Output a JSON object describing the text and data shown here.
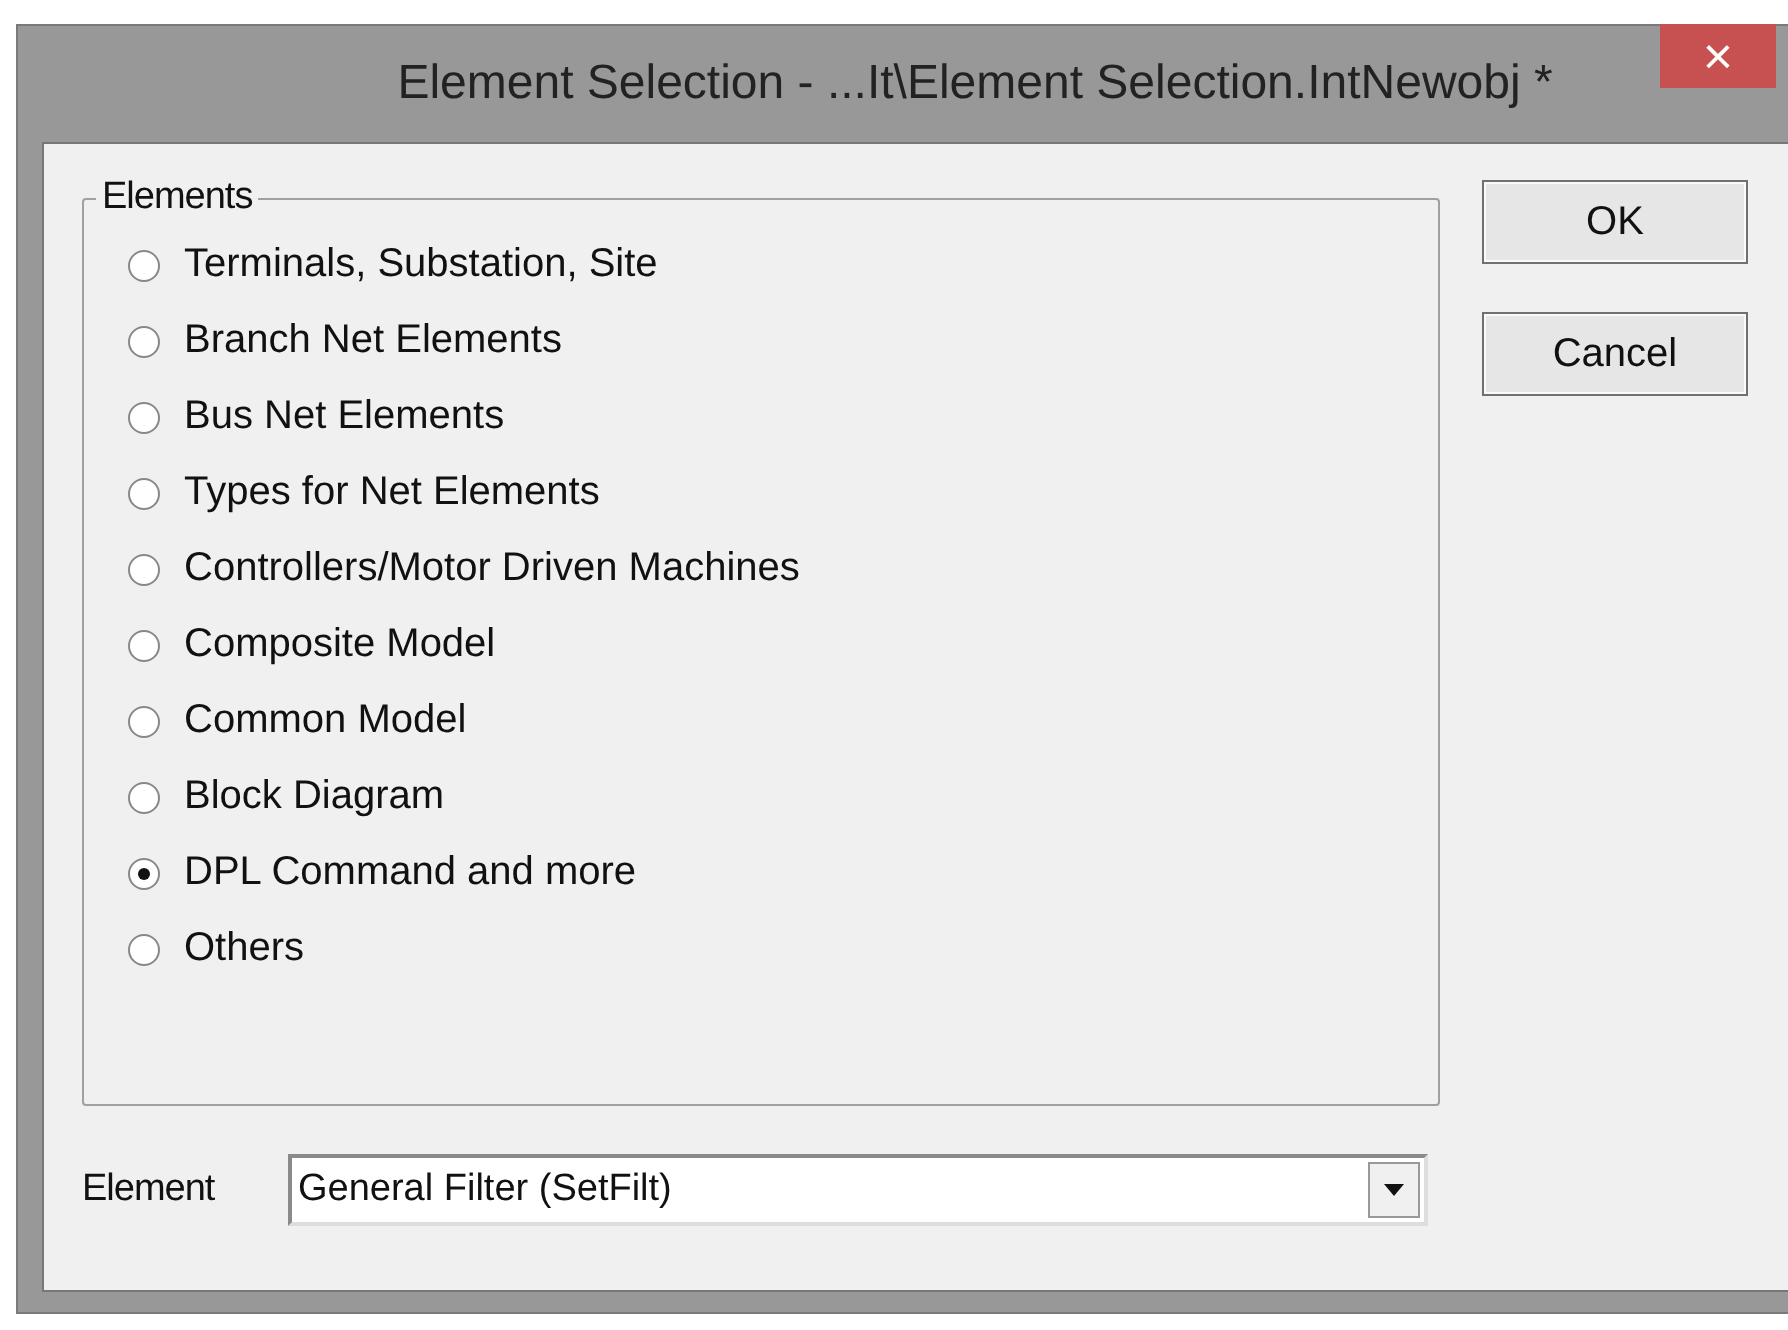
{
  "window": {
    "title": "Element Selection - ...It\\Element Selection.IntNewobj *",
    "close": "×"
  },
  "group": {
    "title": "Elements",
    "options": [
      {
        "label": "Terminals, Substation, Site",
        "selected": false
      },
      {
        "label": "Branch Net Elements",
        "selected": false
      },
      {
        "label": "Bus Net Elements",
        "selected": false
      },
      {
        "label": "Types for Net Elements",
        "selected": false
      },
      {
        "label": "Controllers/Motor Driven Machines",
        "selected": false
      },
      {
        "label": "Composite Model",
        "selected": false
      },
      {
        "label": "Common Model",
        "selected": false
      },
      {
        "label": "Block Diagram",
        "selected": false
      },
      {
        "label": "DPL Command and more",
        "selected": true
      },
      {
        "label": "Others",
        "selected": false
      }
    ]
  },
  "element": {
    "label": "Element",
    "value": "General Filter (SetFilt)"
  },
  "buttons": [
    "OK",
    "Cancel"
  ]
}
